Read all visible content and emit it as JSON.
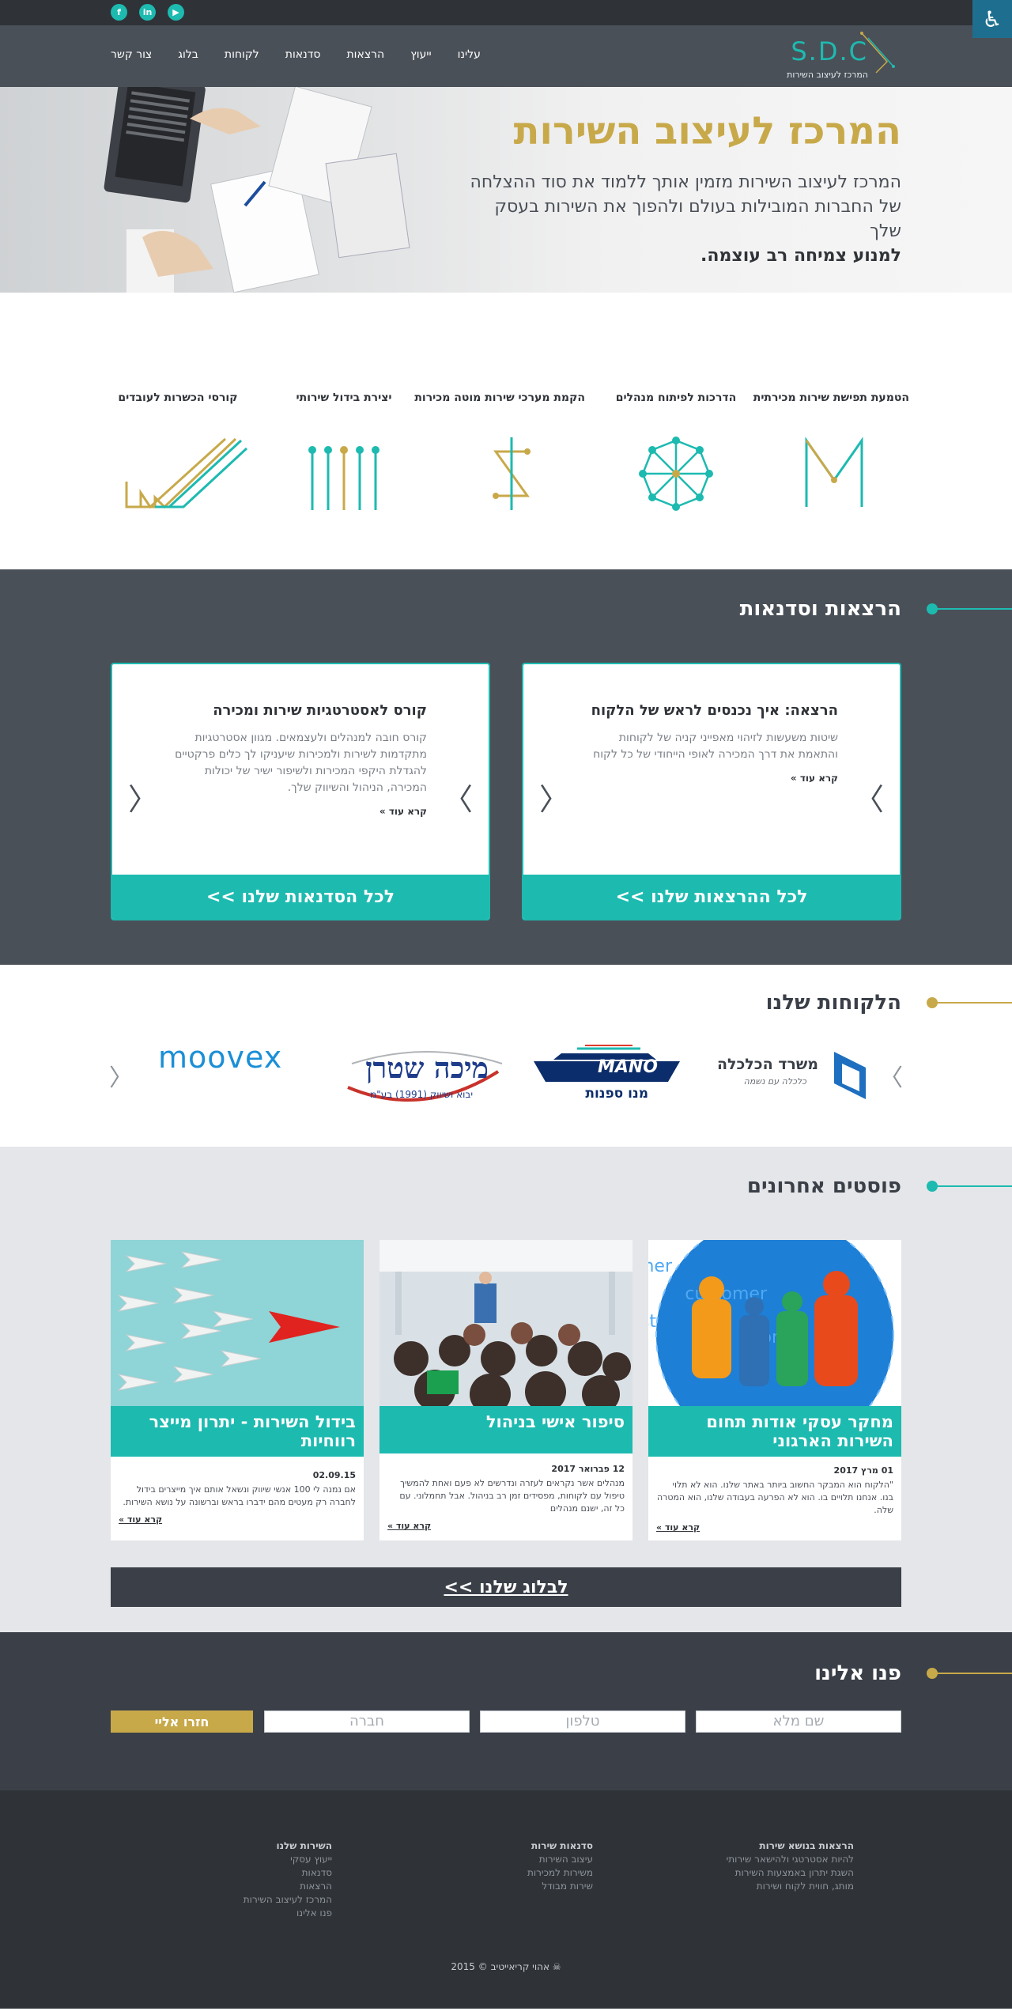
{
  "top": {
    "social": [
      {
        "icon": "facebook-icon",
        "glyph": "f"
      },
      {
        "icon": "linkedin-icon",
        "glyph": "in"
      },
      {
        "icon": "youtube-icon",
        "glyph": "▶"
      }
    ],
    "accessibility_icon": "accessibility-icon"
  },
  "header": {
    "logo_letters": "S.D.C",
    "logo_sub": "המרכז לעיצוב השירות",
    "nav": [
      "עלינו",
      "ייעוץ",
      "הרצאות",
      "סדנאות",
      "לקוחות",
      "בלוג",
      "צור קשר"
    ]
  },
  "hero": {
    "title": "המרכז לעיצוב השירות",
    "line1": "המרכז לעיצוב השירות מזמין אותך ללמוד את סוד ההצלחה",
    "line2": "של החברות המובילות בעולם ולהפוך את השירות בעסק שלך",
    "line3": "למנוע צמיחה רב עוצמה."
  },
  "services": [
    {
      "title": "הטמעת תפישת שירות מכירתית",
      "icon": "m-shape-icon"
    },
    {
      "title": "הדרכות לפיתוח מנהלים",
      "icon": "network-star-icon"
    },
    {
      "title": "הקמת מערכי שירות מוטה מכירות",
      "icon": "s-dollar-icon"
    },
    {
      "title": "יצירת בידול שירותי",
      "icon": "pins-icon"
    },
    {
      "title": "קורסי הכשרות לעובדים",
      "icon": "wave-lines-icon"
    }
  ],
  "lectures": {
    "title": "הרצאות וסדנאות",
    "cards": [
      {
        "title": "הרצאה: איך נכנסים לראש של הלקוח",
        "desc": "שיטות משעשות לזיהוי מאפייני קניה של לקוחות והתאמת את דרך המכירה לאופי הייחודי של כל לקוח",
        "more": "קרא עוד »",
        "cta": "לכל ההרצאות שלנו >>"
      },
      {
        "title": "קורס לאסטרטגיות שירות ומכירה",
        "desc": "קורס חובה למנהלים ולעצמאים. מגוון אסטרטגיות מתקדמות לשירות ולמכירות שיעניקו לך כלים פרקטיים להגדלת היקפי המכירות ולשיפור ישיר של יכולות המכירה, הניהול והשיווק שלך.",
        "more": "קרא עוד »",
        "cta": "לכל הסדנאות שלנו >>"
      }
    ]
  },
  "clients": {
    "title": "הלקוחות שלנו",
    "logos": [
      {
        "name": "משרד הכלכלה",
        "sub": "כלכלה עם נשמה"
      },
      {
        "name": "MANO",
        "sub": "מנו ספנות"
      },
      {
        "name": "מיכה שטרן",
        "sub": "יבוא ושיווק (1991) בע\"מ"
      },
      {
        "name": "moovex",
        "sub": ""
      }
    ]
  },
  "posts": {
    "title": "פוסטים אחרונים",
    "items": [
      {
        "title": "מחקר עסקי אודות תחום השירות הארגוני",
        "date": "01 מרץ 2017",
        "excerpt": "\"הלקוח הוא המבקר החשוב ביותר באתר שלנו. הוא לא תלוי בנו. אנחנו תלויים בו. הוא לא הפרעה בעבודה שלנו, הוא המטרה שלה.",
        "more": "קרא עוד »"
      },
      {
        "title": "סיפור אישי בניהול",
        "date": "12 פברואר 2017",
        "excerpt": "מנהלים אשר נקראים לעזרה ונדרשים לא פעם ואחת להמשיך טיפול עם לקוחות, מפסידים זמן רב בניהול. אבל תחמלוני. עם כל זה, ישנם מנהלים",
        "more": "קרא עוד »"
      },
      {
        "title": "בידול השירות - יתרון מייצר רווחיות",
        "date": "02.09.15",
        "excerpt": "אם נמנה לי 100 אנשי שיווק ונשאל אותם איך מייצרים בידול לחברה רק מעטים מהם ידברו בראש וברשונה על נושא השירות.",
        "more": "קרא עוד »"
      }
    ],
    "blog_button": "לבלוג שלנו >>"
  },
  "contact": {
    "title": "פנו אלינו",
    "fields": [
      "שם מלא",
      "טלפון",
      "חברה"
    ],
    "submit": "חזרו אליי"
  },
  "footer": {
    "cols": [
      {
        "head": "הרצאות בנושא שירות",
        "items": [
          "להיות אסטרטגי ולהישאר שירותי",
          "השגת יתרון באמצעות השירות",
          "מותג, חווית לקוח ושירות"
        ]
      },
      {
        "head": "סדנאות שירות",
        "items": [
          "עיצוב השירות",
          "משירות למכירות",
          "שירות מבודל"
        ]
      },
      {
        "head": "השירות שלנו",
        "items": [
          "ייעוץ עסקי",
          "סדנאות",
          "הרצאות",
          "המרכז לעיצוב השירות",
          "פנו אלינו"
        ]
      }
    ],
    "copyright": "אהוי קריאייטיב © 2015"
  },
  "colors": {
    "teal": "#1dbab0",
    "gold": "#c8a94a",
    "dark": "#4a5058",
    "darker": "#2f3338"
  }
}
